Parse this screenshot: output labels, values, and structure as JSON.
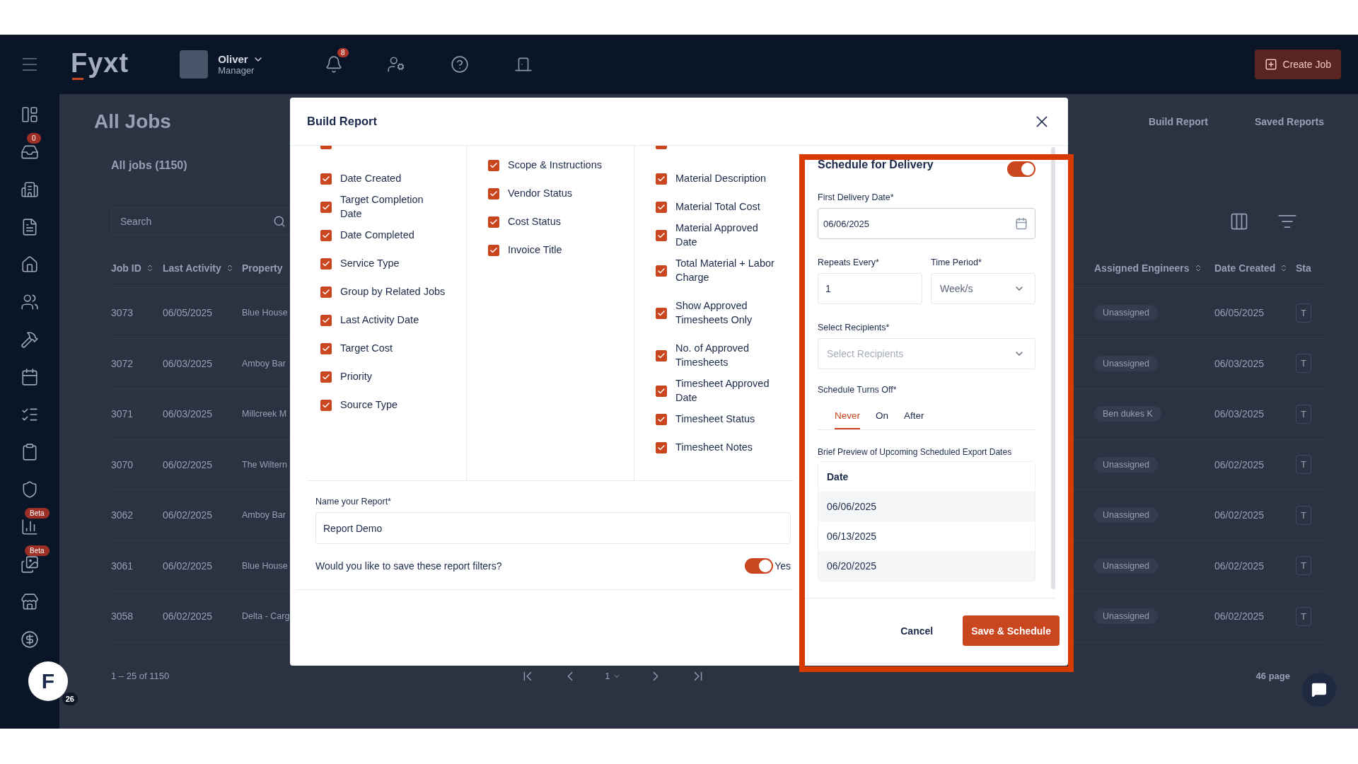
{
  "topbar": {
    "logo": "Fyxt",
    "user": {
      "name": "Oliver",
      "role": "Manager"
    },
    "notification_count": "8",
    "create_button": "Create Job"
  },
  "sidebar": {
    "inbox_badge": "0",
    "reports_badge": "Beta",
    "gallery_badge": "Beta"
  },
  "page": {
    "title": "All Jobs",
    "links": [
      "Build Report",
      "Saved Reports"
    ]
  },
  "jobs": {
    "title": "All jobs (1150)",
    "search": {
      "placeholder": "Search"
    },
    "columns_left": [
      "Job ID",
      "Last Activity",
      "Property"
    ],
    "columns_right": [
      "Assigned Engineers",
      "Date Created",
      "Sta"
    ],
    "rows": [
      {
        "job_id": "3073",
        "last_activity": "06/05/2025",
        "property": "Blue House",
        "engineer": "Unassigned",
        "date_created": "06/05/2025",
        "status": "T"
      },
      {
        "job_id": "3072",
        "last_activity": "06/03/2025",
        "property": "Amboy Bar",
        "engineer": "Unassigned",
        "date_created": "06/03/2025",
        "status": "T"
      },
      {
        "job_id": "3071",
        "last_activity": "06/03/2025",
        "property": "Millcreek M",
        "engineer": "Ben dukes K",
        "date_created": "06/03/2025",
        "status": "T"
      },
      {
        "job_id": "3070",
        "last_activity": "06/02/2025",
        "property": "The Wiltern",
        "engineer": "Unassigned",
        "date_created": "06/02/2025",
        "status": "T"
      },
      {
        "job_id": "3062",
        "last_activity": "06/02/2025",
        "property": "Amboy Bar",
        "engineer": "Unassigned",
        "date_created": "06/02/2025",
        "status": "T"
      },
      {
        "job_id": "3061",
        "last_activity": "06/02/2025",
        "property": "Blue House",
        "engineer": "Unassigned",
        "date_created": "06/02/2025",
        "status": "T"
      },
      {
        "job_id": "3058",
        "last_activity": "06/02/2025",
        "property": "Delta - Carg",
        "engineer": "Unassigned",
        "date_created": "06/02/2025",
        "status": "T"
      }
    ],
    "range": "1 – 25 of 1150",
    "page": "1",
    "pages": "46 page"
  },
  "help_widget": {
    "letter": "F",
    "count": "26"
  },
  "modal": {
    "title": "Build Report",
    "columns": [
      {
        "top_cut_checkbox": {
          "checked": true
        },
        "items": [
          {
            "label": "Date Created",
            "checked": true
          },
          {
            "label": "Target Completion Date",
            "checked": true
          },
          {
            "label": "Date Completed",
            "checked": true
          },
          {
            "label": "Service Type",
            "checked": true
          },
          {
            "label": "Group by Related Jobs",
            "checked": true
          },
          {
            "label": "Last Activity Date",
            "checked": true
          },
          {
            "label": "Target Cost",
            "checked": true
          },
          {
            "label": "Priority",
            "checked": true
          },
          {
            "label": "Source Type",
            "checked": true
          }
        ]
      },
      {
        "items": [
          {
            "label": "Scope & Instructions",
            "checked": true
          },
          {
            "label": "Vendor Status",
            "checked": true
          },
          {
            "label": "Cost Status",
            "checked": true
          },
          {
            "label": "Invoice Title",
            "checked": true
          }
        ]
      },
      {
        "top_cut_checkbox": {
          "checked": true
        },
        "items": [
          {
            "label": "Material Description",
            "checked": true
          },
          {
            "label": "Material Total Cost",
            "checked": true
          },
          {
            "label": "Material Approved Date",
            "checked": true
          },
          {
            "label": "Total Material + Labor Charge",
            "checked": true
          },
          {
            "label": "Show Approved Timesheets Only",
            "checked": true
          },
          {
            "label": "No. of Approved Timesheets",
            "checked": true
          },
          {
            "label": "Timesheet Approved Date",
            "checked": true
          },
          {
            "label": "Timesheet Status",
            "checked": true
          },
          {
            "label": "Timesheet Notes",
            "checked": true
          }
        ]
      }
    ],
    "report_name": {
      "label": "Name your Report*",
      "value": "Report Demo"
    },
    "save_filters": {
      "question": "Would you like to save these report filters?",
      "on": true,
      "label": "Yes"
    },
    "schedule": {
      "title": "Schedule for Delivery",
      "on": true,
      "first_date": {
        "label": "First Delivery Date*",
        "value": "06/06/2025"
      },
      "repeats": {
        "label": "Repeats Every*",
        "value": "1"
      },
      "period": {
        "label": "Time Period*",
        "value": "Week/s"
      },
      "recipients": {
        "label": "Select Recipients*",
        "placeholder": "Select Recipients"
      },
      "turns_off": {
        "label": "Schedule Turns Off*",
        "options": [
          {
            "label": "Never",
            "selected": true
          },
          {
            "label": "On",
            "selected": false
          },
          {
            "label": "After",
            "selected": false
          }
        ]
      },
      "preview": {
        "title": "Brief Preview of Upcoming Scheduled Export Dates",
        "column": "Date",
        "rows": [
          "06/06/2025",
          "06/13/2025",
          "06/20/2025"
        ]
      }
    },
    "buttons": {
      "cancel": "Cancel",
      "save": "Save & Schedule"
    }
  }
}
